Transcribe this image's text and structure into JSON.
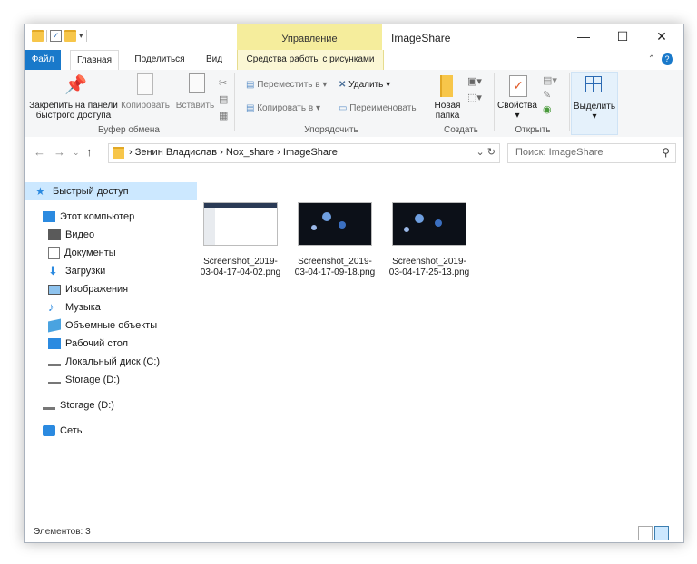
{
  "window": {
    "title": "ImageShare",
    "contextual_tab_title": "Управление",
    "controls": {
      "minimize": "—",
      "maximize": "☐",
      "close": "✕"
    }
  },
  "tabs": [
    "Файл",
    "Главная",
    "Поделиться",
    "Вид",
    "Средства работы с рисунками"
  ],
  "ribbon": {
    "clipboard": {
      "pin_label": "Закрепить на панели быстрого доступа",
      "copy_label": "Копировать",
      "paste_label": "Вставить",
      "group_label": "Буфер обмена"
    },
    "organize": {
      "move_label": "Переместить в",
      "copy_to_label": "Копировать в",
      "delete_label": "Удалить",
      "rename_label": "Переименовать",
      "group_label": "Упорядочить"
    },
    "new": {
      "new_folder_label": "Новая папка",
      "group_label": "Создать"
    },
    "open": {
      "properties_label": "Свойства",
      "group_label": "Открыть"
    },
    "select": {
      "select_label": "Выделить"
    }
  },
  "address": {
    "crumbs": "›  Зенин Владислав  ›  Nox_share  ›  ImageShare",
    "search_placeholder": "Поиск: ImageShare"
  },
  "sidebar": {
    "items": [
      {
        "label": "Быстрый доступ",
        "icon": "star-icon"
      },
      {
        "label": "Этот компьютер",
        "icon": "computer-icon"
      },
      {
        "label": "Видео",
        "icon": "video-icon"
      },
      {
        "label": "Документы",
        "icon": "documents-icon"
      },
      {
        "label": "Загрузки",
        "icon": "download-icon"
      },
      {
        "label": "Изображения",
        "icon": "pictures-icon"
      },
      {
        "label": "Музыка",
        "icon": "music-icon"
      },
      {
        "label": "Объемные объекты",
        "icon": "3d-objects-icon"
      },
      {
        "label": "Рабочий стол",
        "icon": "desktop-icon"
      },
      {
        "label": "Локальный диск (C:)",
        "icon": "drive-icon"
      },
      {
        "label": "Storage (D:)",
        "icon": "drive-icon"
      },
      {
        "label": "Storage (D:)",
        "icon": "drive-icon"
      },
      {
        "label": "Сеть",
        "icon": "network-icon"
      }
    ]
  },
  "files": [
    {
      "name": "Screenshot_2019-03-04-17-04-02.png"
    },
    {
      "name": "Screenshot_2019-03-04-17-09-18.png"
    },
    {
      "name": "Screenshot_2019-03-04-17-25-13.png"
    }
  ],
  "status": {
    "items_count": "Элементов: 3"
  },
  "colors": {
    "accent": "#1979ca",
    "selection": "#cce8ff",
    "contextual_band": "#f5ed9c"
  }
}
